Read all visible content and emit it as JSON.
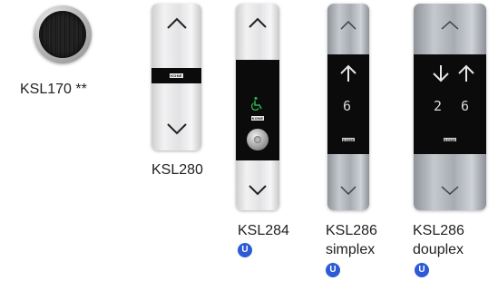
{
  "products": [
    {
      "model": "KSL170 **",
      "badge": ""
    },
    {
      "model": "KSL280",
      "badge": ""
    },
    {
      "model": "KSL284",
      "badge": "U"
    },
    {
      "model": "KSL286",
      "variant": "simplex",
      "badge": "U",
      "floor": "6"
    },
    {
      "model": "KSL286",
      "variant": "douplex",
      "badge": "U",
      "floor_left": "2",
      "floor_right": "6"
    }
  ],
  "logo_text": "KONE",
  "colors": {
    "badge": "#2d5bd6",
    "panel_dark": "#0b0b0c",
    "accessibility_icon": "#2bb24c"
  }
}
